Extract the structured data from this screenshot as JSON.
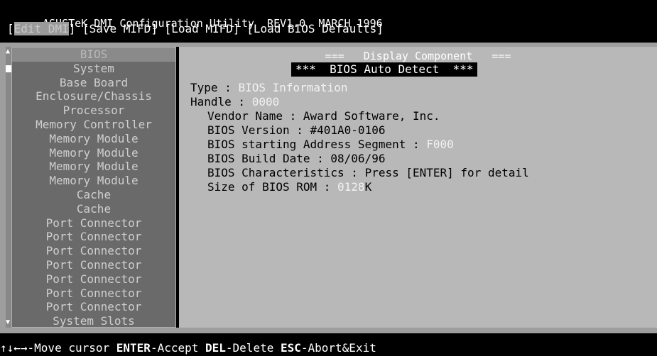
{
  "title": "ASUSTeK DMI Configuration Utility  REV1.0  MARCH 1996",
  "menu": {
    "edit_dmi": "Edit DMI",
    "save_mifd": "Save MIFD",
    "load_mifd": "Load MIFD",
    "load_bios_defaults": "Load BIOS Defaults"
  },
  "sidebar": {
    "items": [
      {
        "label": "BIOS"
      },
      {
        "label": "System"
      },
      {
        "label": "Base Board"
      },
      {
        "label": "Enclosure/Chassis"
      },
      {
        "label": "Processor"
      },
      {
        "label": "Memory Controller"
      },
      {
        "label": "Memory Module"
      },
      {
        "label": "Memory Module"
      },
      {
        "label": "Memory Module"
      },
      {
        "label": "Memory Module"
      },
      {
        "label": "Cache"
      },
      {
        "label": "Cache"
      },
      {
        "label": "Port Connector"
      },
      {
        "label": "Port Connector"
      },
      {
        "label": "Port Connector"
      },
      {
        "label": "Port Connector"
      },
      {
        "label": "Port Connector"
      },
      {
        "label": "Port Connector"
      },
      {
        "label": "Port Connector"
      },
      {
        "label": "System Slots"
      }
    ]
  },
  "panel": {
    "title": "===   Display Component   ===",
    "subtitle": "***  BIOS Auto Detect  ***",
    "type_label": "Type : ",
    "type_value": "BIOS Information",
    "handle_label": "Handle : ",
    "handle_value": "0000",
    "vendor_label": "Vendor Name : ",
    "vendor_value": "Award Software, Inc.",
    "version_label": "BIOS Version : ",
    "version_value": "#401A0-0106",
    "segment_label": "BIOS starting Address Segment : ",
    "segment_value": "F000",
    "date_label": "BIOS Build Date : ",
    "date_value": "08/06/96",
    "chars_label": "BIOS Characteristics : ",
    "chars_value": "Press [ENTER] for detail",
    "size_label": "Size of BIOS ROM : ",
    "size_value": "0128",
    "size_unit": "K"
  },
  "status": {
    "arrows": "↑↓←→",
    "move": "-Move cursor ",
    "enter_key": "ENTER",
    "enter": "-Accept ",
    "del_key": "DEL",
    "del": "-Delete ",
    "esc_key": "ESC",
    "esc": "-Abort&Exit"
  }
}
